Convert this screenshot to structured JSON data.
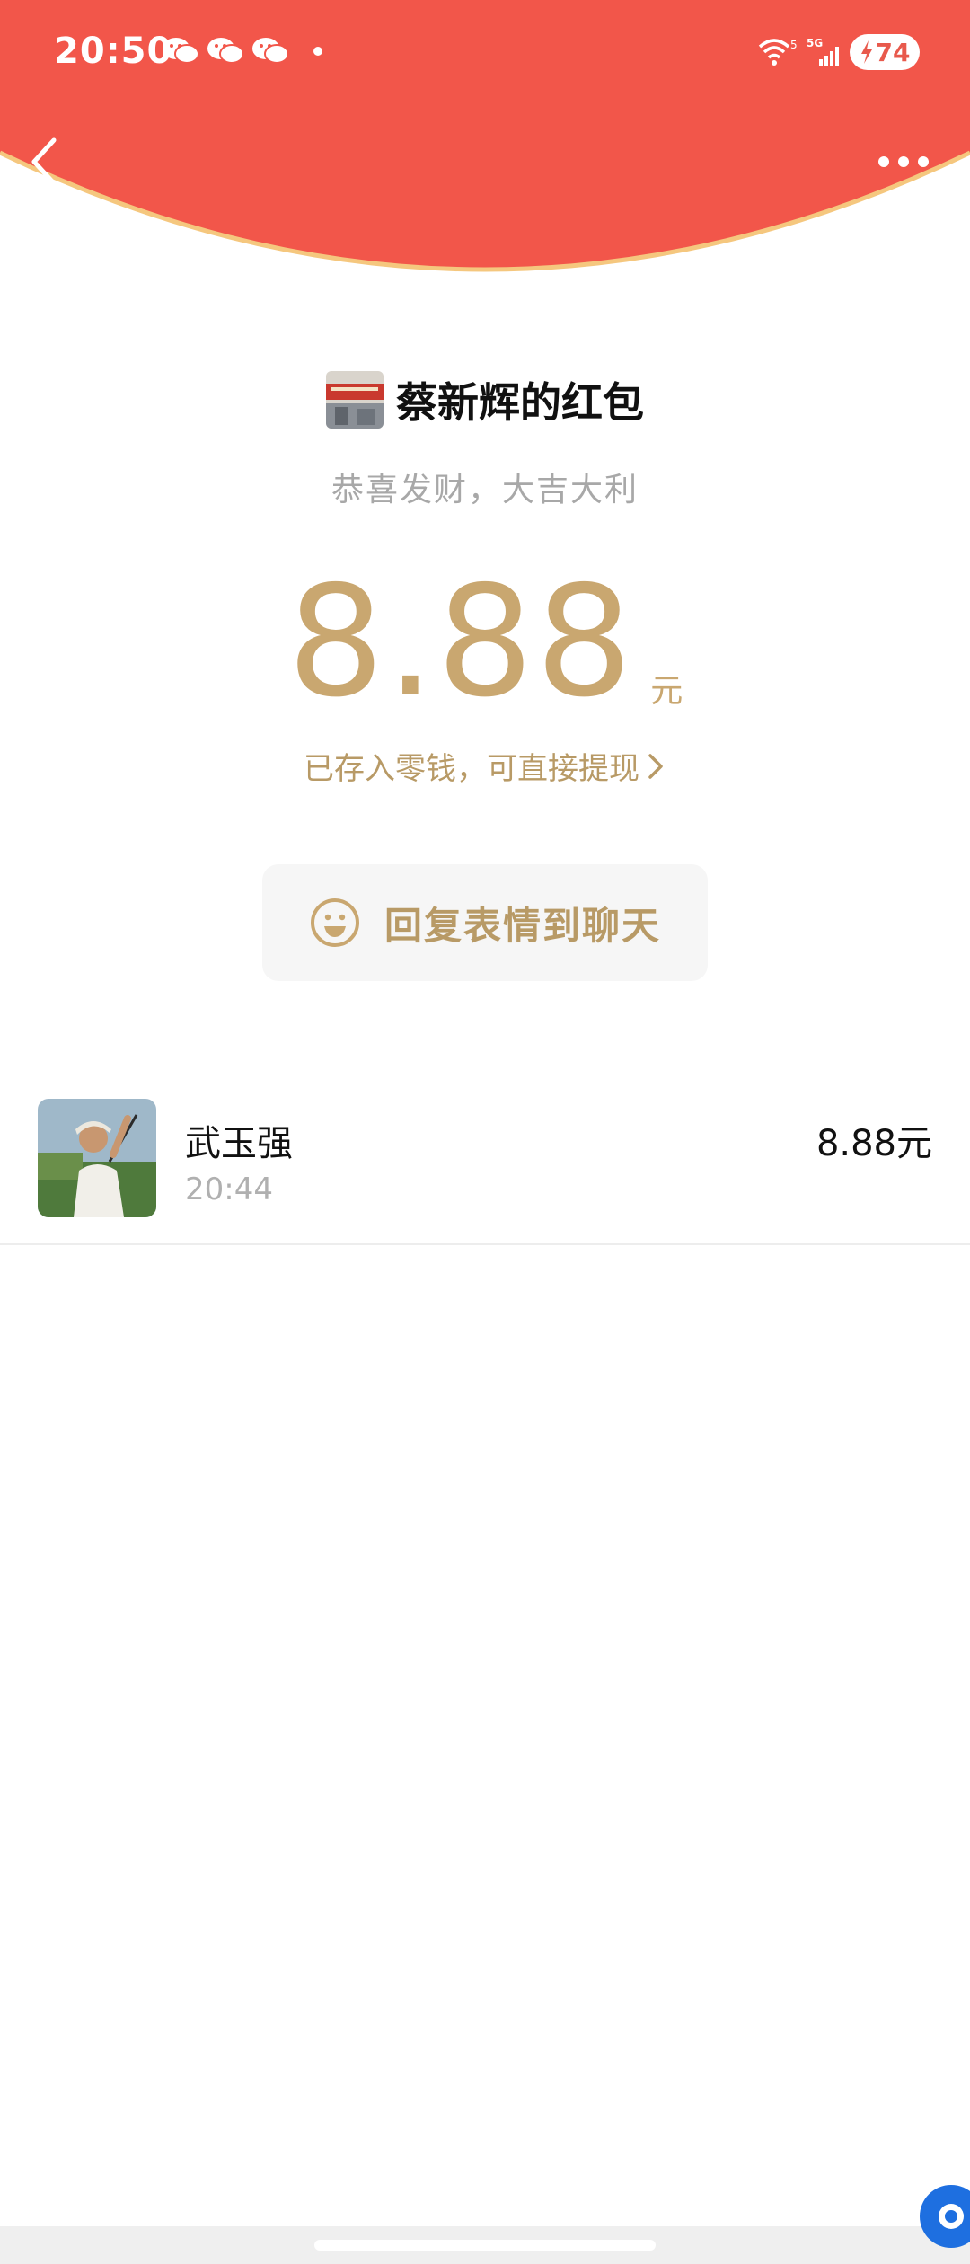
{
  "status_bar": {
    "time": "20:50",
    "wifi_badge": "5",
    "network": "5G",
    "battery": "74"
  },
  "colors": {
    "header_red": "#F2564A",
    "header_border": "#F5C77E",
    "gold": "#C9A770"
  },
  "icons": {
    "back": "chevron-left-icon",
    "more": "more-dots-icon",
    "smile": "smile-icon",
    "wallet_chevron": "chevron-right-icon"
  },
  "header": {
    "sender_title": "蔡新辉的红包",
    "greeting": "恭喜发财，大吉大利"
  },
  "amount": {
    "value": "8.88",
    "unit": "元",
    "note": "已存入零钱，可直接提现"
  },
  "reply": {
    "label": "回复表情到聊天"
  },
  "records": [
    {
      "name": "武玉强",
      "time": "20:44",
      "amount": "8.88元"
    }
  ]
}
